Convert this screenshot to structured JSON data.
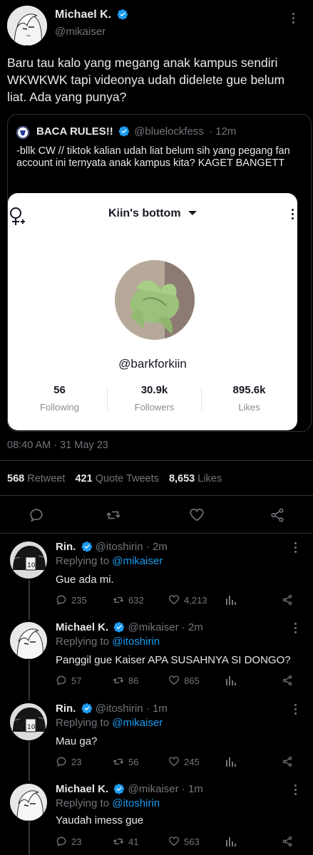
{
  "main_tweet": {
    "display_name": "Michael K.",
    "handle": "@mikaiser",
    "text": "Baru tau kalo yang megang anak kampus sendiri WKWKWK tapi videonya udah didelete gue belum liat. Ada yang punya?",
    "timestamp": "08:40 AM · 31 May 23",
    "stats": {
      "retweets": "568",
      "retweets_label": "Retweet",
      "quotes": "421",
      "quotes_label": "Quote Tweets",
      "likes": "8,653",
      "likes_label": "Likes"
    }
  },
  "quoted_tweet": {
    "display_name": "BACA RULES!!",
    "handle": "@bluelockfess",
    "time": "· 12m",
    "text": "-bllk CW // tiktok kalian udah liat belum sih yang pegang fan account ini ternyata anak kampus kita? KAGET BANGETT"
  },
  "tiktok_card": {
    "account_name": "Kiin's bottom",
    "username": "@barkforkiin",
    "stats": [
      {
        "value": "56",
        "label": "Following"
      },
      {
        "value": "30.9k",
        "label": "Followers"
      },
      {
        "value": "895.6k",
        "label": "Likes"
      }
    ]
  },
  "replies": [
    {
      "display_name": "Rin.",
      "handle": "@itoshirin",
      "time": "· 2m",
      "replying_prefix": "Replying to",
      "replying_to": "@mikaiser",
      "text": "Gue ada mi.",
      "replies": "235",
      "retweets": "632",
      "likes": "4,213"
    },
    {
      "display_name": "Michael K.",
      "handle": "@mikaiser",
      "time": "· 2m",
      "replying_prefix": "Replying to",
      "replying_to": "@itoshirin",
      "text": "Panggil gue Kaiser APA SUSAHNYA SI DONGO?",
      "replies": "57",
      "retweets": "86",
      "likes": "865"
    },
    {
      "display_name": "Rin.",
      "handle": "@itoshirin",
      "time": "· 1m",
      "replying_prefix": "Replying to",
      "replying_to": "@mikaiser",
      "text": "Mau ga?",
      "replies": "23",
      "retweets": "56",
      "likes": "245"
    },
    {
      "display_name": "Michael K.",
      "handle": "@mikaiser",
      "time": "· 1m",
      "replying_prefix": "Replying to",
      "replying_to": "@itoshirin",
      "text": "Yaudah imess gue",
      "replies": "23",
      "retweets": "41",
      "likes": "563"
    }
  ],
  "colors": {
    "accent": "#1d9bf0",
    "background": "#000000",
    "muted": "#71767b"
  }
}
